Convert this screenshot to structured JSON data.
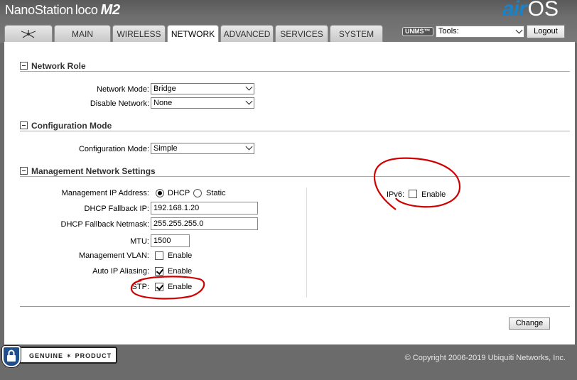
{
  "header": {
    "product_model": "NanoStation",
    "product_sub": "loco",
    "product_gen": "M2",
    "brand_air": "air",
    "brand_os": "OS"
  },
  "tabs": [
    {
      "label": "",
      "icon": "ubiquiti-logo-icon"
    },
    {
      "label": "MAIN"
    },
    {
      "label": "WIRELESS"
    },
    {
      "label": "NETWORK",
      "active": true
    },
    {
      "label": "ADVANCED"
    },
    {
      "label": "SERVICES"
    },
    {
      "label": "SYSTEM"
    }
  ],
  "toolbar": {
    "unms_label": "UNMS",
    "tools_value": "Tools:",
    "logout_label": "Logout"
  },
  "sections": {
    "network_role": {
      "title": "Network Role",
      "network_mode_label": "Network Mode:",
      "network_mode_value": "Bridge",
      "disable_network_label": "Disable Network:",
      "disable_network_value": "None"
    },
    "configuration_mode": {
      "title": "Configuration Mode",
      "configuration_mode_label": "Configuration Mode:",
      "configuration_mode_value": "Simple"
    },
    "management": {
      "title": "Management Network Settings",
      "mgmt_ip_label": "Management IP Address:",
      "dhcp_option": "DHCP",
      "static_option": "Static",
      "dhcp_fallback_ip_label": "DHCP Fallback IP:",
      "dhcp_fallback_ip_value": "192.168.1.20",
      "dhcp_fallback_netmask_label": "DHCP Fallback Netmask:",
      "dhcp_fallback_netmask_value": "255.255.255.0",
      "mtu_label": "MTU:",
      "mtu_value": "1500",
      "mgmt_vlan_label": "Management VLAN:",
      "mgmt_vlan_option": "Enable",
      "auto_ip_label": "Auto IP Aliasing:",
      "auto_ip_option": "Enable",
      "stp_label": "STP:",
      "stp_option": "Enable",
      "ipv6_label": "IPv6:",
      "ipv6_option": "Enable"
    }
  },
  "actions": {
    "change_label": "Change"
  },
  "footer": {
    "badge_left": "GENUINE",
    "badge_right": "PRODUCT",
    "copyright": "© Copyright 2006-2019 Ubiquiti Networks, Inc."
  },
  "colors": {
    "brand_blue": "#1a82c8",
    "annotation_red": "#d00000"
  }
}
